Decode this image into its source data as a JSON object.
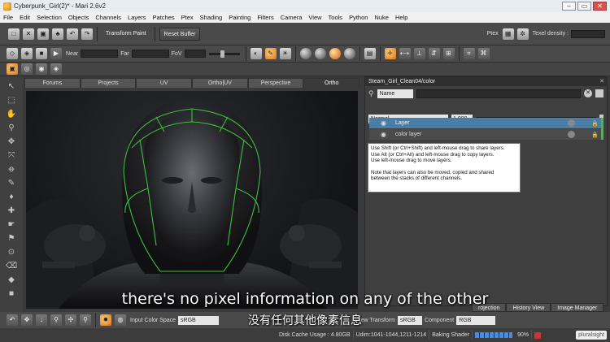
{
  "window": {
    "title": "Cyberpunk_Girl(2)* - Mari 2.6v2",
    "minimize": "–",
    "restore": "▭",
    "close": "✕"
  },
  "menu": [
    "File",
    "Edit",
    "Selection",
    "Objects",
    "Channels",
    "Layers",
    "Patches",
    "Ptex",
    "Shading",
    "Painting",
    "Filters",
    "Camera",
    "View",
    "Tools",
    "Python",
    "Nuke",
    "Help"
  ],
  "toolbar": {
    "transform_paint": "Transform Paint",
    "reset_buffer": "Reset Buffer",
    "ptex_label": "Ptex",
    "texel_density": "Texel density :",
    "near": "Near",
    "far": "Far",
    "fov": "FoV"
  },
  "view_tabs": [
    "Forums",
    "Projects",
    "UV",
    "Ortho|UV",
    "Perspective",
    "Ortho"
  ],
  "view_active": "Ortho",
  "layers_panel": {
    "title": "Steam_Girl_Clean04/color",
    "search_mode": "Name",
    "blend_mode": "Normal",
    "opacity": "1.000",
    "layers": [
      {
        "name": "Layer",
        "selected": true
      },
      {
        "name": "color layer",
        "selected": false
      }
    ]
  },
  "tooltip": {
    "line1": "Use Shift (or Ctrl+Shift) and left-mouse drag to share layers.",
    "line2": "Use Alt (or Ctrl+Alt) and left-mouse drag to copy layers.",
    "line3": "Use left-mouse drag to move layers.",
    "line4": "Note that layers can also be moved, copied and shared",
    "line5": "between the stacks of different channels."
  },
  "right_bottom_tabs": [
    "rojection",
    "History View",
    "Image Manager"
  ],
  "bottom_bar": {
    "input_color_space_label": "Input Color Space",
    "input_color_space": "sRGB",
    "view_transform_label": "iew Transform",
    "view_transform": "sRGB",
    "component_label": "Component",
    "component": "RGB"
  },
  "status": {
    "disk_cache": "Disk Cache Usage : 4.80GB",
    "udim": "Udim:1041-1044,1211-1214",
    "baking": "Baking Shader",
    "percent": "90%",
    "brand": "pluralsight",
    "progress": 0.9
  },
  "subtitles": {
    "en": "there's no pixel information on any of the other",
    "zh": "没有任何其他像素信息"
  },
  "colors": {
    "accent_selected": "#4a7da6",
    "viewport_wire": "#3fbf3f",
    "active_tool": "#ffa640"
  }
}
